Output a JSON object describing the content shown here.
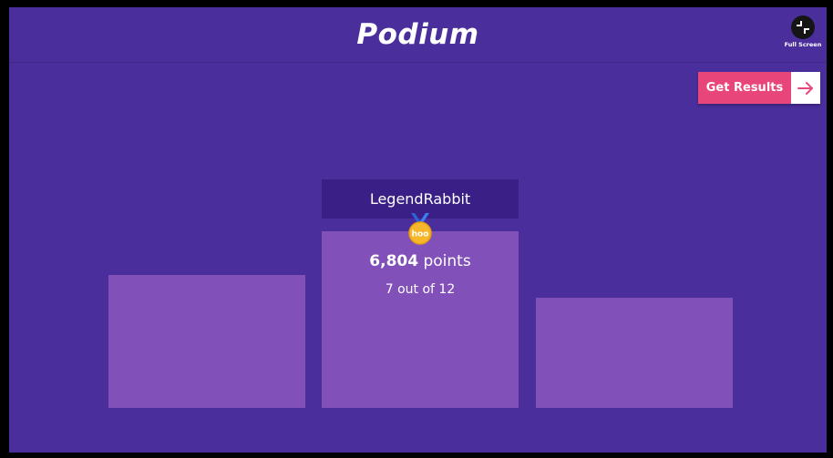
{
  "header": {
    "title": "Podium",
    "fullscreen_label": "Full Screen"
  },
  "actions": {
    "get_results_label": "Get Results"
  },
  "podium": {
    "first_place": {
      "name": "LegendRabbit",
      "medal_text": "hoo",
      "points_value": "6,804",
      "points_unit": "points",
      "score": "7 out of 12"
    }
  },
  "colors": {
    "background": "#4a2f9c",
    "podium_block": "#8150b8",
    "name_tag": "#3a1f86",
    "button_accent": "#e8457a",
    "medal_gold": "#f6b72a"
  },
  "icons": {
    "fullscreen": "fullscreen-icon",
    "results_arrow": "arrow-right-icon",
    "medal": "medal-icon"
  }
}
